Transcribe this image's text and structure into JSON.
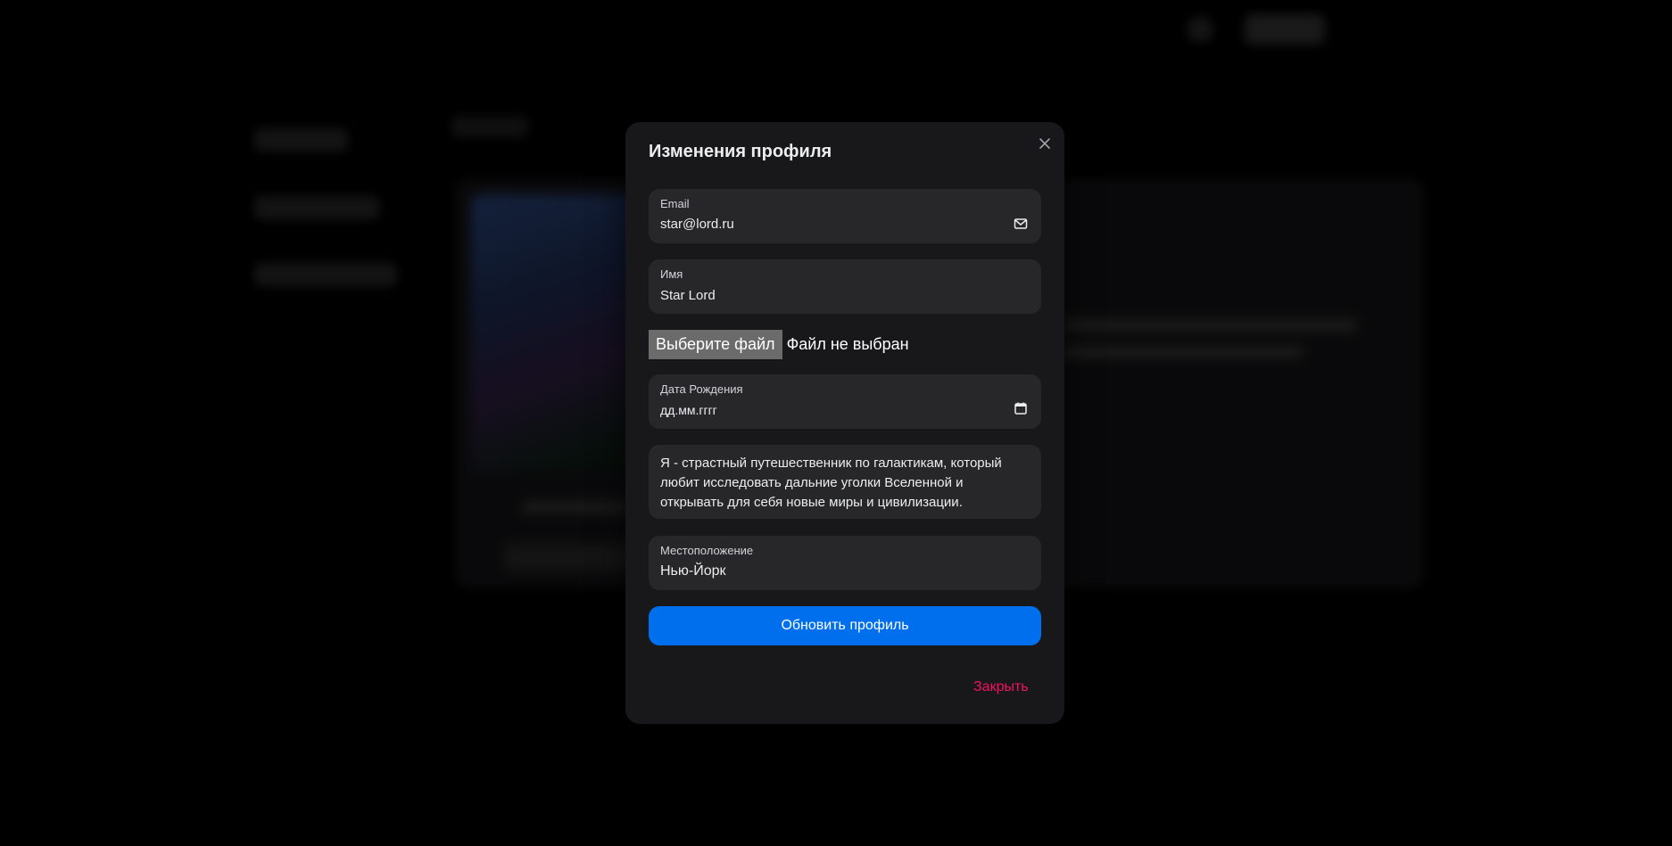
{
  "modal": {
    "title": "Изменения профиля",
    "close_icon": "close-icon"
  },
  "form": {
    "email": {
      "label": "Email",
      "value": "star@lord.ru",
      "icon": "mail-icon"
    },
    "name": {
      "label": "Имя",
      "value": "Star Lord"
    },
    "file": {
      "button_label": "Выберите файл",
      "status": "Файл не выбран"
    },
    "birthdate": {
      "label": "Дата Рождения",
      "placeholder": "дд.мм.гггг",
      "icon": "calendar-icon"
    },
    "bio": {
      "value": "Я - страстный путешественник по галактикам, который любит исследовать дальние уголки Вселенной и открывать для себя новые миры и цивилизации."
    },
    "location": {
      "label": "Местоположение",
      "value": "Нью-Йорк"
    },
    "submit_label": "Обновить профиль"
  },
  "footer": {
    "close_label": "Закрыть"
  },
  "colors": {
    "primary": "#006fee",
    "danger": "#f31260",
    "modal_bg": "#18181b",
    "field_bg": "#27272a"
  }
}
